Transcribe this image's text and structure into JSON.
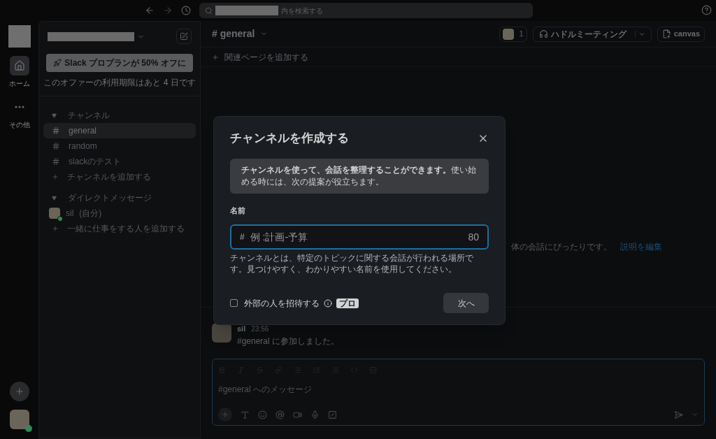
{
  "topbar": {
    "search": {
      "placeholder": "内を検索する"
    }
  },
  "rail": {
    "items": [
      {
        "label": "ホーム",
        "selected": true,
        "kind": "home"
      },
      {
        "label": "その他",
        "selected": false,
        "kind": "more"
      }
    ]
  },
  "sidebar": {
    "promo": {
      "button": "Slack プロプランが 50% オフに",
      "note": "このオファーの利用期限はあと 4 日です"
    },
    "items": [
      {
        "kind": "section",
        "label": "チャンネル",
        "expanded": true
      },
      {
        "kind": "channel",
        "label": "general",
        "selected": true
      },
      {
        "kind": "channel",
        "label": "random",
        "selected": false
      },
      {
        "kind": "channel",
        "label": "slackのテスト",
        "selected": false
      },
      {
        "kind": "add",
        "label": "チャンネルを追加する"
      },
      {
        "kind": "section",
        "label": "ダイレクトメッセージ",
        "expanded": true
      },
      {
        "kind": "dm",
        "label": "sil",
        "suffix": "(自分)",
        "online": true
      },
      {
        "kind": "add",
        "label": "一緒に仕事をする人を追加する"
      }
    ]
  },
  "channel": {
    "title": "# general",
    "member_count": "1",
    "huddle": "ハドルミーティング",
    "canvas": "canvas",
    "add_bookmark": "関連ページを追加する",
    "intro_tail": "体の会話にぴったりです。",
    "edit_link": "説明を編集",
    "messages": [
      {
        "author": "sil",
        "time": "23:56",
        "text": "#general に参加しました。"
      }
    ],
    "composer": {
      "placeholder": "#general へのメッセージ"
    }
  },
  "dialog": {
    "title": "チャンネルを作成する",
    "info": "**チャンネルを使って、会話を整理することができます。**使い始める時には、次の提案が役立ちます。",
    "name_label": "名前",
    "name_field": {
      "prefix": "#",
      "placeholder": "例 :計画-予算",
      "remaining": "80"
    },
    "hint": "チャンネルとは、特定のトピックに関する会話が行われる場所です。見つけやすく、わかりやすい名前を使用してください。",
    "external": {
      "label": "外部の人を招待する",
      "checked": false,
      "badge": "プロ"
    },
    "next_button": "次へ"
  }
}
